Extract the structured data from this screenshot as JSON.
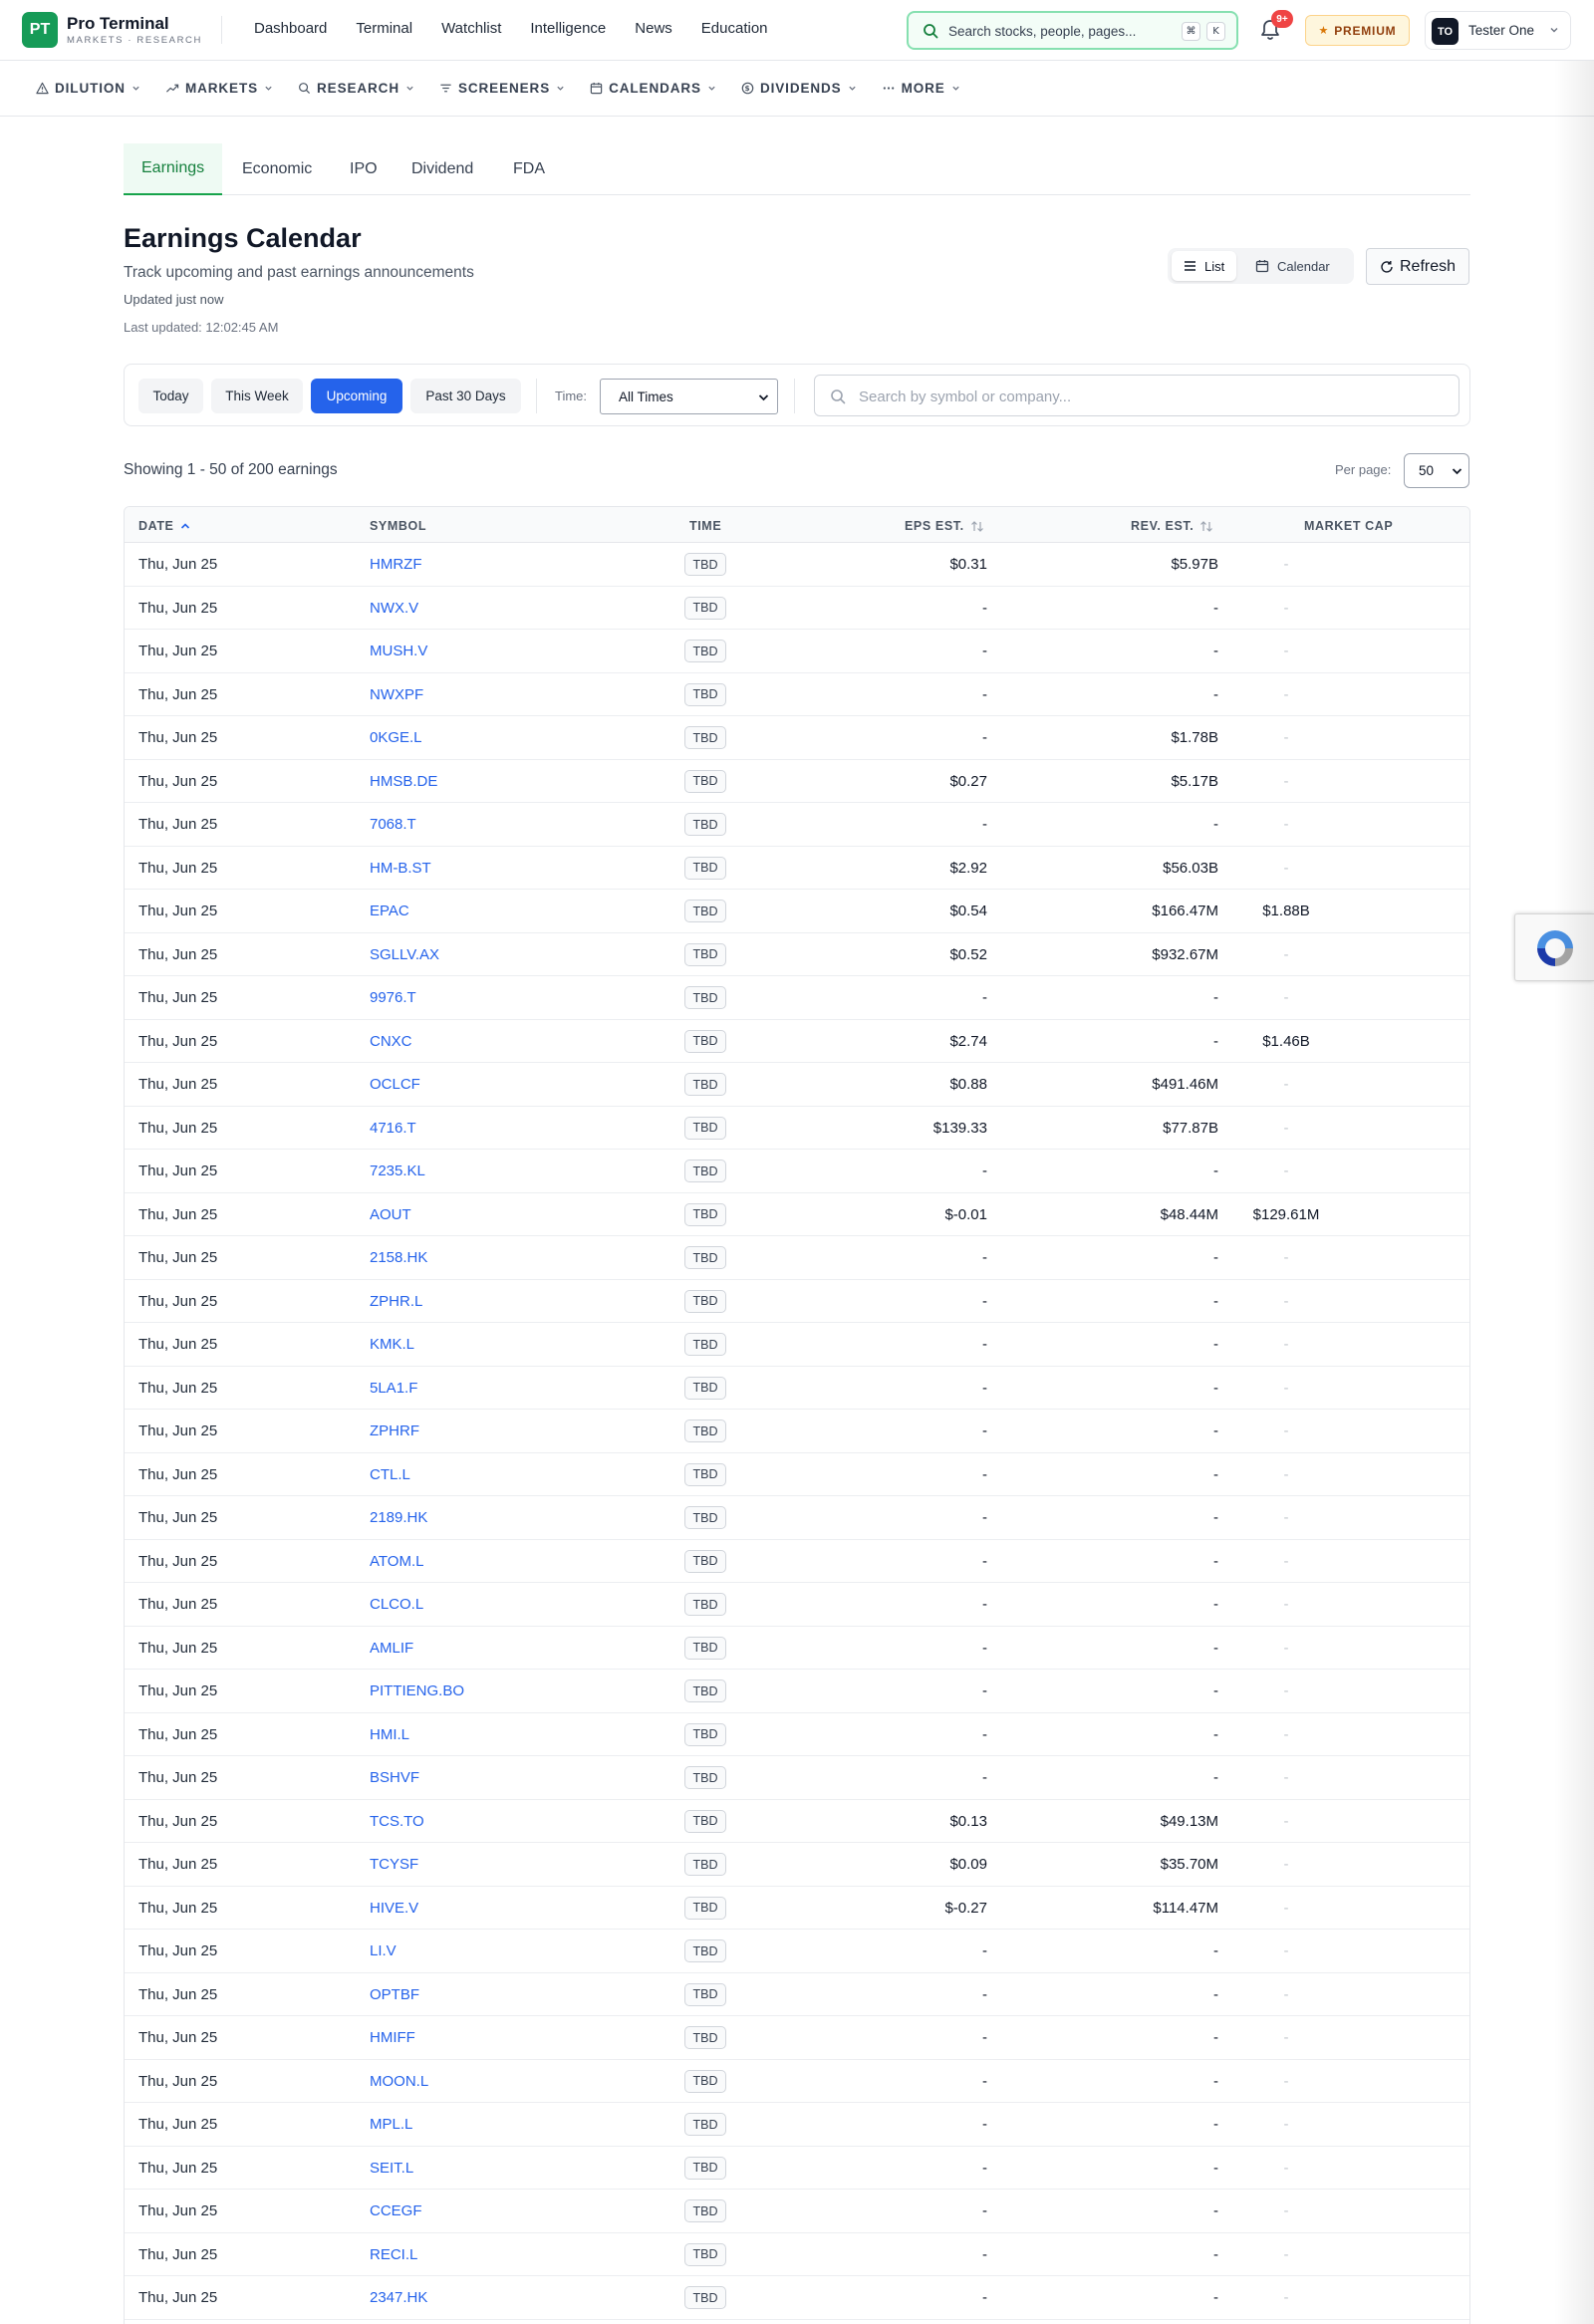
{
  "brand": {
    "logo": "PT",
    "name": "Pro Terminal",
    "tagline": "MARKETS · RESEARCH"
  },
  "topnav": [
    "Dashboard",
    "Terminal",
    "Watchlist",
    "Intelligence",
    "News",
    "Education"
  ],
  "search": {
    "placeholder": "Search stocks, people, pages...",
    "kbd1": "⌘",
    "kbd2": "K",
    "icon": "search-icon"
  },
  "notifications": {
    "badge": "9+",
    "icon": "bell-icon"
  },
  "premium": {
    "label": "PREMIUM",
    "icon": "star-icon"
  },
  "user": {
    "initials": "TO",
    "name": "Tester One"
  },
  "subnav": [
    {
      "label": "DILUTION",
      "icon": "warning-icon"
    },
    {
      "label": "MARKETS",
      "icon": "trend-icon"
    },
    {
      "label": "RESEARCH",
      "icon": "search-icon"
    },
    {
      "label": "SCREENERS",
      "icon": "filter-icon"
    },
    {
      "label": "CALENDARS",
      "icon": "calendar-icon"
    },
    {
      "label": "DIVIDENDS",
      "icon": "dollar-icon"
    },
    {
      "label": "MORE",
      "icon": "more-icon"
    }
  ],
  "tabs": [
    "Earnings",
    "Economic",
    "IPO",
    "Dividend",
    "FDA"
  ],
  "header": {
    "title": "Earnings Calendar",
    "subtitle": "Track upcoming and past earnings announcements",
    "updated": "Updated just now",
    "last_updated": "Last updated: 12:02:45 AM"
  },
  "view_toggle": {
    "list": "List",
    "calendar": "Calendar"
  },
  "refresh_label": "Refresh",
  "filters": {
    "ranges": [
      "Today",
      "This Week",
      "Upcoming",
      "Past 30 Days"
    ],
    "active_range": "Upcoming",
    "time_label": "Time:",
    "time_value": "All Times",
    "search_placeholder": "Search by symbol or company..."
  },
  "showing": "Showing 1 - 50 of 200 earnings",
  "per_page": {
    "label": "Per page:",
    "value": "50"
  },
  "colors": {
    "accent": "#16a34a",
    "primary": "#2563eb",
    "badge": "#ef4444"
  },
  "table": {
    "columns": [
      "DATE",
      "SYMBOL",
      "TIME",
      "EPS EST.",
      "REV. EST.",
      "MARKET CAP"
    ],
    "rows": [
      {
        "date": "Thu, Jun 25",
        "symbol": "HMRZF",
        "time": "TBD",
        "eps": "$0.31",
        "rev": "$5.97B",
        "mcap": "-"
      },
      {
        "date": "Thu, Jun 25",
        "symbol": "NWX.V",
        "time": "TBD",
        "eps": "-",
        "rev": "-",
        "mcap": "-"
      },
      {
        "date": "Thu, Jun 25",
        "symbol": "MUSH.V",
        "time": "TBD",
        "eps": "-",
        "rev": "-",
        "mcap": "-"
      },
      {
        "date": "Thu, Jun 25",
        "symbol": "NWXPF",
        "time": "TBD",
        "eps": "-",
        "rev": "-",
        "mcap": "-"
      },
      {
        "date": "Thu, Jun 25",
        "symbol": "0KGE.L",
        "time": "TBD",
        "eps": "-",
        "rev": "$1.78B",
        "mcap": "-"
      },
      {
        "date": "Thu, Jun 25",
        "symbol": "HMSB.DE",
        "time": "TBD",
        "eps": "$0.27",
        "rev": "$5.17B",
        "mcap": "-"
      },
      {
        "date": "Thu, Jun 25",
        "symbol": "7068.T",
        "time": "TBD",
        "eps": "-",
        "rev": "-",
        "mcap": "-"
      },
      {
        "date": "Thu, Jun 25",
        "symbol": "HM-B.ST",
        "time": "TBD",
        "eps": "$2.92",
        "rev": "$56.03B",
        "mcap": "-"
      },
      {
        "date": "Thu, Jun 25",
        "symbol": "EPAC",
        "time": "TBD",
        "eps": "$0.54",
        "rev": "$166.47M",
        "mcap": "$1.88B"
      },
      {
        "date": "Thu, Jun 25",
        "symbol": "SGLLV.AX",
        "time": "TBD",
        "eps": "$0.52",
        "rev": "$932.67M",
        "mcap": "-"
      },
      {
        "date": "Thu, Jun 25",
        "symbol": "9976.T",
        "time": "TBD",
        "eps": "-",
        "rev": "-",
        "mcap": "-"
      },
      {
        "date": "Thu, Jun 25",
        "symbol": "CNXC",
        "time": "TBD",
        "eps": "$2.74",
        "rev": "-",
        "mcap": "$1.46B"
      },
      {
        "date": "Thu, Jun 25",
        "symbol": "OCLCF",
        "time": "TBD",
        "eps": "$0.88",
        "rev": "$491.46M",
        "mcap": "-"
      },
      {
        "date": "Thu, Jun 25",
        "symbol": "4716.T",
        "time": "TBD",
        "eps": "$139.33",
        "rev": "$77.87B",
        "mcap": "-"
      },
      {
        "date": "Thu, Jun 25",
        "symbol": "7235.KL",
        "time": "TBD",
        "eps": "-",
        "rev": "-",
        "mcap": "-"
      },
      {
        "date": "Thu, Jun 25",
        "symbol": "AOUT",
        "time": "TBD",
        "eps": "$-0.01",
        "rev": "$48.44M",
        "mcap": "$129.61M"
      },
      {
        "date": "Thu, Jun 25",
        "symbol": "2158.HK",
        "time": "TBD",
        "eps": "-",
        "rev": "-",
        "mcap": "-"
      },
      {
        "date": "Thu, Jun 25",
        "symbol": "ZPHR.L",
        "time": "TBD",
        "eps": "-",
        "rev": "-",
        "mcap": "-"
      },
      {
        "date": "Thu, Jun 25",
        "symbol": "KMK.L",
        "time": "TBD",
        "eps": "-",
        "rev": "-",
        "mcap": "-"
      },
      {
        "date": "Thu, Jun 25",
        "symbol": "5LA1.F",
        "time": "TBD",
        "eps": "-",
        "rev": "-",
        "mcap": "-"
      },
      {
        "date": "Thu, Jun 25",
        "symbol": "ZPHRF",
        "time": "TBD",
        "eps": "-",
        "rev": "-",
        "mcap": "-"
      },
      {
        "date": "Thu, Jun 25",
        "symbol": "CTL.L",
        "time": "TBD",
        "eps": "-",
        "rev": "-",
        "mcap": "-"
      },
      {
        "date": "Thu, Jun 25",
        "symbol": "2189.HK",
        "time": "TBD",
        "eps": "-",
        "rev": "-",
        "mcap": "-"
      },
      {
        "date": "Thu, Jun 25",
        "symbol": "ATOM.L",
        "time": "TBD",
        "eps": "-",
        "rev": "-",
        "mcap": "-"
      },
      {
        "date": "Thu, Jun 25",
        "symbol": "CLCO.L",
        "time": "TBD",
        "eps": "-",
        "rev": "-",
        "mcap": "-"
      },
      {
        "date": "Thu, Jun 25",
        "symbol": "AMLIF",
        "time": "TBD",
        "eps": "-",
        "rev": "-",
        "mcap": "-"
      },
      {
        "date": "Thu, Jun 25",
        "symbol": "PITTIENG.BO",
        "time": "TBD",
        "eps": "-",
        "rev": "-",
        "mcap": "-"
      },
      {
        "date": "Thu, Jun 25",
        "symbol": "HMI.L",
        "time": "TBD",
        "eps": "-",
        "rev": "-",
        "mcap": "-"
      },
      {
        "date": "Thu, Jun 25",
        "symbol": "BSHVF",
        "time": "TBD",
        "eps": "-",
        "rev": "-",
        "mcap": "-"
      },
      {
        "date": "Thu, Jun 25",
        "symbol": "TCS.TO",
        "time": "TBD",
        "eps": "$0.13",
        "rev": "$49.13M",
        "mcap": "-"
      },
      {
        "date": "Thu, Jun 25",
        "symbol": "TCYSF",
        "time": "TBD",
        "eps": "$0.09",
        "rev": "$35.70M",
        "mcap": "-"
      },
      {
        "date": "Thu, Jun 25",
        "symbol": "HIVE.V",
        "time": "TBD",
        "eps": "$-0.27",
        "rev": "$114.47M",
        "mcap": "-"
      },
      {
        "date": "Thu, Jun 25",
        "symbol": "LI.V",
        "time": "TBD",
        "eps": "-",
        "rev": "-",
        "mcap": "-"
      },
      {
        "date": "Thu, Jun 25",
        "symbol": "OPTBF",
        "time": "TBD",
        "eps": "-",
        "rev": "-",
        "mcap": "-"
      },
      {
        "date": "Thu, Jun 25",
        "symbol": "HMIFF",
        "time": "TBD",
        "eps": "-",
        "rev": "-",
        "mcap": "-"
      },
      {
        "date": "Thu, Jun 25",
        "symbol": "MOON.L",
        "time": "TBD",
        "eps": "-",
        "rev": "-",
        "mcap": "-"
      },
      {
        "date": "Thu, Jun 25",
        "symbol": "MPL.L",
        "time": "TBD",
        "eps": "-",
        "rev": "-",
        "mcap": "-"
      },
      {
        "date": "Thu, Jun 25",
        "symbol": "SEIT.L",
        "time": "TBD",
        "eps": "-",
        "rev": "-",
        "mcap": "-"
      },
      {
        "date": "Thu, Jun 25",
        "symbol": "CCEGF",
        "time": "TBD",
        "eps": "-",
        "rev": "-",
        "mcap": "-"
      },
      {
        "date": "Thu, Jun 25",
        "symbol": "RECI.L",
        "time": "TBD",
        "eps": "-",
        "rev": "-",
        "mcap": "-"
      },
      {
        "date": "Thu, Jun 25",
        "symbol": "2347.HK",
        "time": "TBD",
        "eps": "-",
        "rev": "-",
        "mcap": "-"
      }
    ]
  }
}
